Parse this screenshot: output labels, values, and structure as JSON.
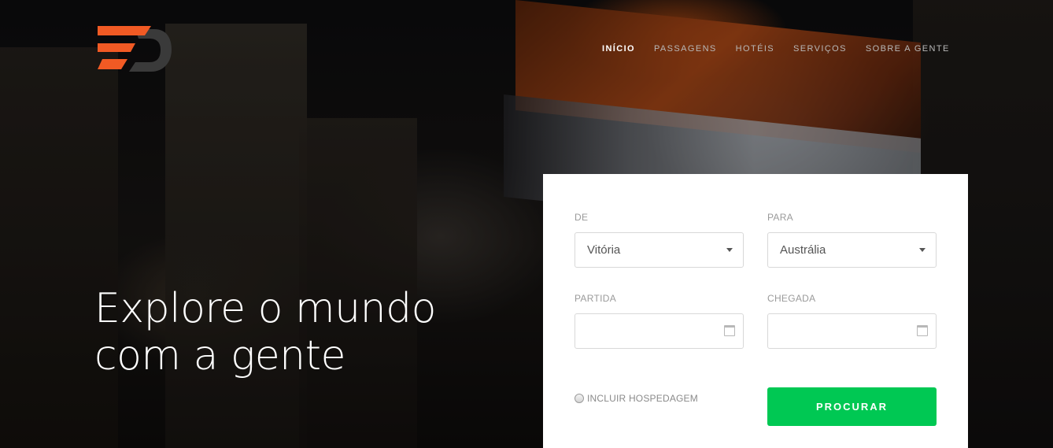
{
  "nav": {
    "items": [
      "INÍCIO",
      "PASSAGENS",
      "HOTÉIS",
      "SERVIÇOS",
      "SOBRE A GENTE"
    ],
    "active": "INÍCIO"
  },
  "hero": {
    "headline_line1": "Explore o mundo",
    "headline_line2": "com a gente"
  },
  "form": {
    "from_label": "DE",
    "from_value": "Vitória",
    "to_label": "PARA",
    "to_value": "Austrália",
    "departure_label": "PARTIDA",
    "arrival_label": "CHEGADA",
    "include_lodging_label": "INCLUIR HOSPEDAGEM",
    "search_button": "PROCURAR"
  },
  "colors": {
    "accent_orange": "#f15a24",
    "logo_dark": "#3a3a3a",
    "search_green": "#00c853"
  }
}
